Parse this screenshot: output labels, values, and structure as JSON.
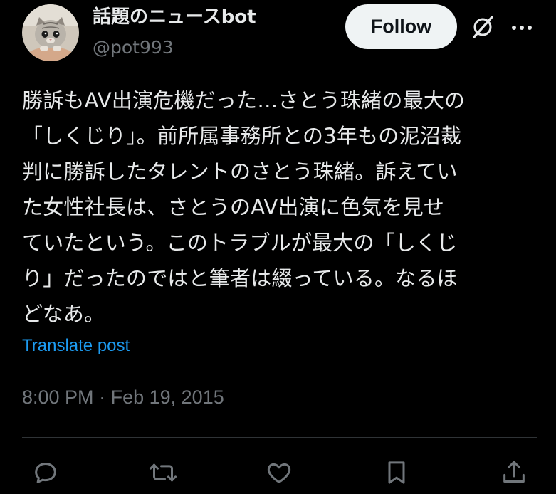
{
  "author": {
    "name": "話題のニュースbot",
    "handle": "@pot993",
    "avatar_icon": "kitten-avatar"
  },
  "header": {
    "follow_label": "Follow",
    "grok_icon": "grok-icon",
    "more_icon": "more-icon"
  },
  "tweet": {
    "lines": [
      "勝訴もAV出演危機だった…さとう珠緒の最大の",
      "「しくじり」。前所属事務所との3年もの泥沼裁",
      "判に勝訴したタレントのさとう珠緒。訴えてい",
      "た女性社長は、さとうのAV出演に色気を見せ",
      "ていたという。このトラブルが最大の「しくじ",
      "り」だったのではと筆者は綴っている。なるほ",
      "どなあ。"
    ],
    "translate_label": "Translate post",
    "time": "8:00 PM",
    "separator": "·",
    "date": "Feb 19, 2015"
  },
  "actions": [
    {
      "name": "reply-icon"
    },
    {
      "name": "repost-icon"
    },
    {
      "name": "like-icon"
    },
    {
      "name": "bookmark-icon"
    },
    {
      "name": "share-icon"
    }
  ],
  "colors": {
    "background": "#000000",
    "text_primary": "#e7e9ea",
    "text_secondary": "#71767b",
    "link": "#1d9bf0",
    "divider": "#2f3336",
    "follow_bg": "#eff3f4"
  }
}
